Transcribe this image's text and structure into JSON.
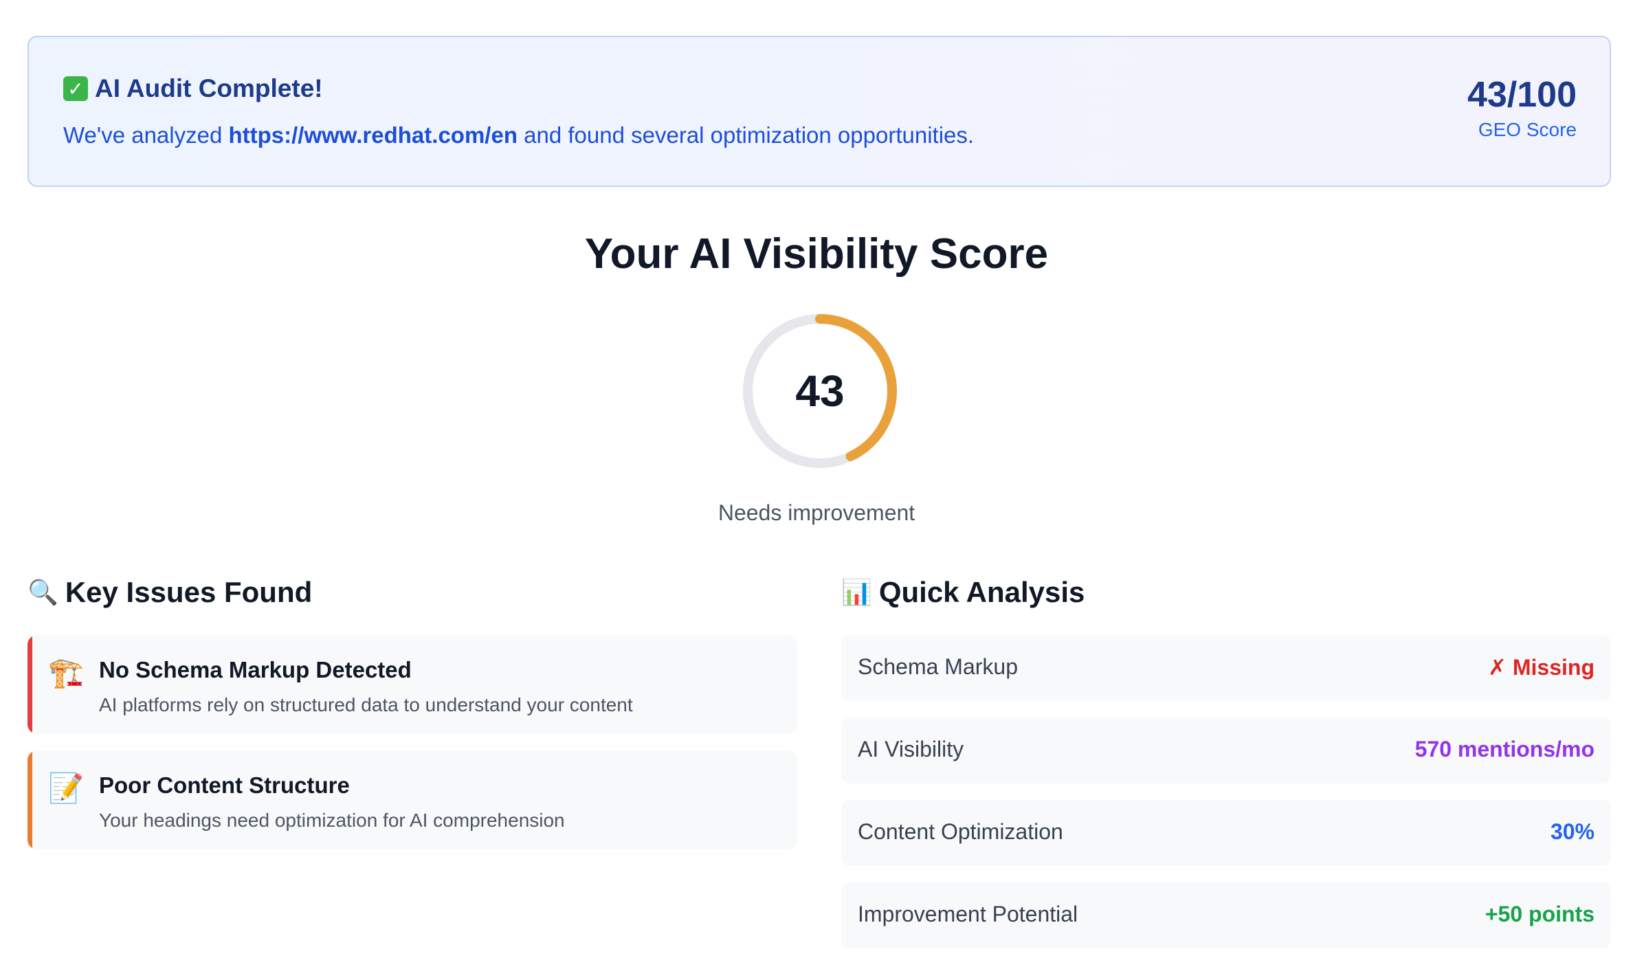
{
  "banner": {
    "check_icon": "check-mark-icon",
    "title": "AI Audit Complete!",
    "text_prefix": "We've analyzed ",
    "url": "https://www.redhat.com/en",
    "text_suffix": " and found several optimization opportunities.",
    "score": "43/100",
    "score_label": "GEO Score"
  },
  "visibility": {
    "title": "Your AI Visibility Score",
    "score": "43",
    "score_value": 43,
    "score_max": 100,
    "status": "Needs improvement",
    "ring_color": "#e9a23b",
    "track_color": "#e5e7eb"
  },
  "issues": {
    "heading_icon": "magnifying-glass-icon",
    "heading": "Key Issues Found",
    "items": [
      {
        "icon": "construction-crane-icon",
        "title": "No Schema Markup Detected",
        "description": "AI platforms rely on structured data to understand your content",
        "accent": "#e53e3e"
      },
      {
        "icon": "memo-icon",
        "title": "Poor Content Structure",
        "description": "Your headings need optimization for AI comprehension",
        "accent": "#ed7b2f"
      }
    ]
  },
  "analysis": {
    "heading_icon": "bar-chart-icon",
    "heading": "Quick Analysis",
    "rows": [
      {
        "label": "Schema Markup",
        "value": "✗ Missing",
        "color": "#dc2626"
      },
      {
        "label": "AI Visibility",
        "value": "570 mentions/mo",
        "color": "#9333ea"
      },
      {
        "label": "Content Optimization",
        "value": "30%",
        "color": "#2563eb"
      },
      {
        "label": "Improvement Potential",
        "value": "+50 points",
        "color": "#16a34a"
      }
    ]
  }
}
